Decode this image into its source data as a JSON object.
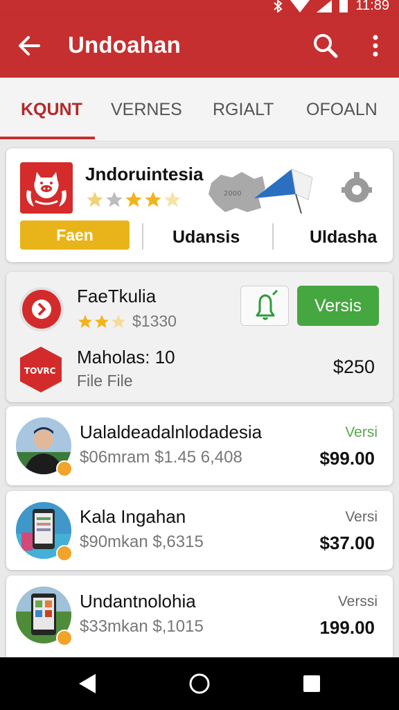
{
  "status_bar": {
    "time": "11:89"
  },
  "app_bar": {
    "title": "Undoahan"
  },
  "tabs": [
    {
      "label": "KQUNT",
      "active": true
    },
    {
      "label": "VERNES"
    },
    {
      "label": "RGIALT"
    },
    {
      "label": "OFOALN"
    }
  ],
  "featured": {
    "name": "Jndoruintesia",
    "stars": 3,
    "button_label": "Faen",
    "options": [
      "Udansis",
      "Uldasha"
    ],
    "map_text": "2000",
    "colors": {
      "logo": "#d52b2b",
      "button": "#e8b419",
      "flag": "#2b6fc0"
    }
  },
  "group_card": {
    "item1": {
      "title": "FaeTkulia",
      "stars": 3,
      "price": "$1330",
      "action_label": "Versis"
    },
    "item2": {
      "title": "Maholas: 10",
      "subtitle": "File File",
      "price": "$250",
      "icon_text": "TOVRC"
    },
    "colors": {
      "action": "#45a740"
    }
  },
  "list_items": [
    {
      "title": "Ualaldeadalnlodadesia",
      "subtitle": "$06mram $1.45 6,408",
      "tag": "Versi",
      "tag_color": "green",
      "price": "$99.00"
    },
    {
      "title": "Kala Ingahan",
      "subtitle": "$90mkan $,6315",
      "tag": "Versi",
      "tag_color": "gray",
      "price": "$37.00"
    },
    {
      "title": "Undantnolohia",
      "subtitle": "$33mkan $,1015",
      "tag": "Verssi",
      "tag_color": "gray",
      "price": "199.00"
    }
  ]
}
